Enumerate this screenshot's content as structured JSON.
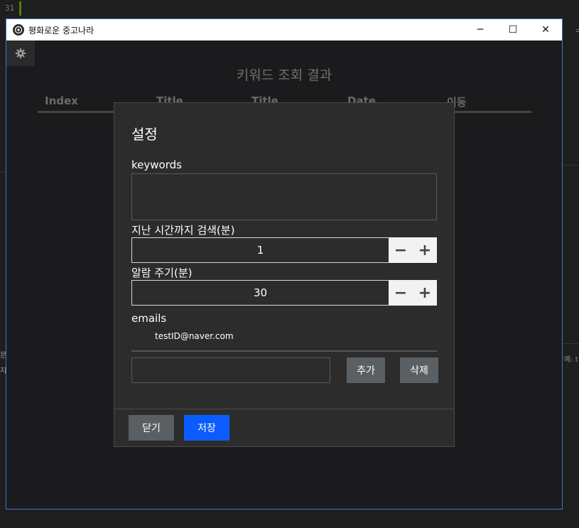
{
  "background": {
    "line_number": "31",
    "side_left_text": "문\n지",
    "side_right_text": "예: t"
  },
  "window": {
    "title": "평화로운 중고나라",
    "controls": {
      "minimize": "─",
      "maximize": "☐",
      "close": "✕"
    }
  },
  "main": {
    "results_title": "키워드 조회 결과",
    "table_headers": [
      "Index",
      "Title",
      "Title",
      "Date",
      "이동"
    ]
  },
  "settings_dialog": {
    "title": "설정",
    "keywords_label": "keywords",
    "keywords_value": "",
    "search_window_label": "지난 시간까지 검색(분)",
    "search_window_value": "1",
    "alarm_label": "알람 주기(분)",
    "alarm_value": "30",
    "emails_label": "emails",
    "emails": [
      "testID@naver.com"
    ],
    "email_input_value": "",
    "add_label": "추가",
    "delete_label": "삭제",
    "close_label": "닫기",
    "save_label": "저장",
    "minus_symbol": "−",
    "plus_symbol": "+"
  },
  "colors": {
    "window_border": "#3a7bd5",
    "save_button": "#0b5cff",
    "gray_button": "#5a5f63"
  }
}
